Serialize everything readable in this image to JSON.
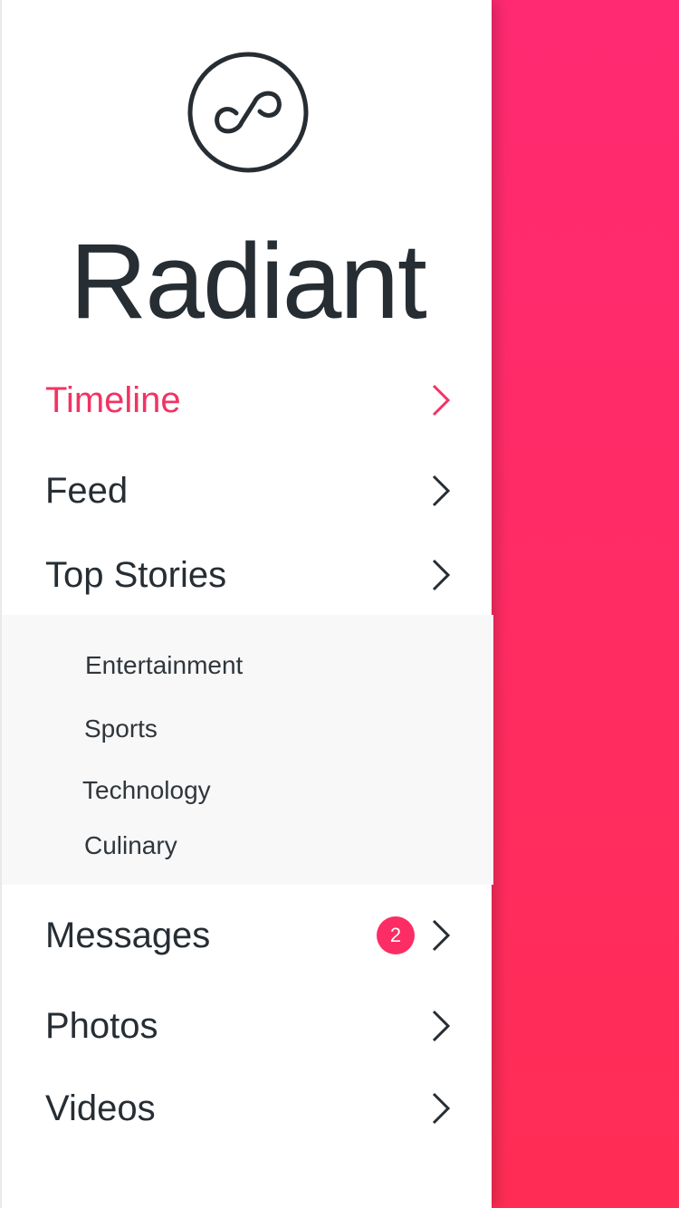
{
  "app": {
    "brand": "Radiant",
    "logo_icon": "infinity-loop-icon"
  },
  "colors": {
    "accent": "#f03463",
    "badge": "#fb2d64",
    "text": "#262d33",
    "submenu_bg": "#f8f8f8",
    "panel_top": "#ff2a72",
    "panel_bottom": "#ff2d55"
  },
  "menu": {
    "items": [
      {
        "label": "Timeline",
        "active": true
      },
      {
        "label": "Feed"
      },
      {
        "label": "Top Stories"
      },
      {
        "label": "Messages",
        "badge": "2"
      },
      {
        "label": "Photos"
      },
      {
        "label": "Videos"
      }
    ],
    "submenu": [
      {
        "label": "Entertainment"
      },
      {
        "label": "Sports"
      },
      {
        "label": "Technology"
      },
      {
        "label": "Culinary"
      }
    ]
  }
}
